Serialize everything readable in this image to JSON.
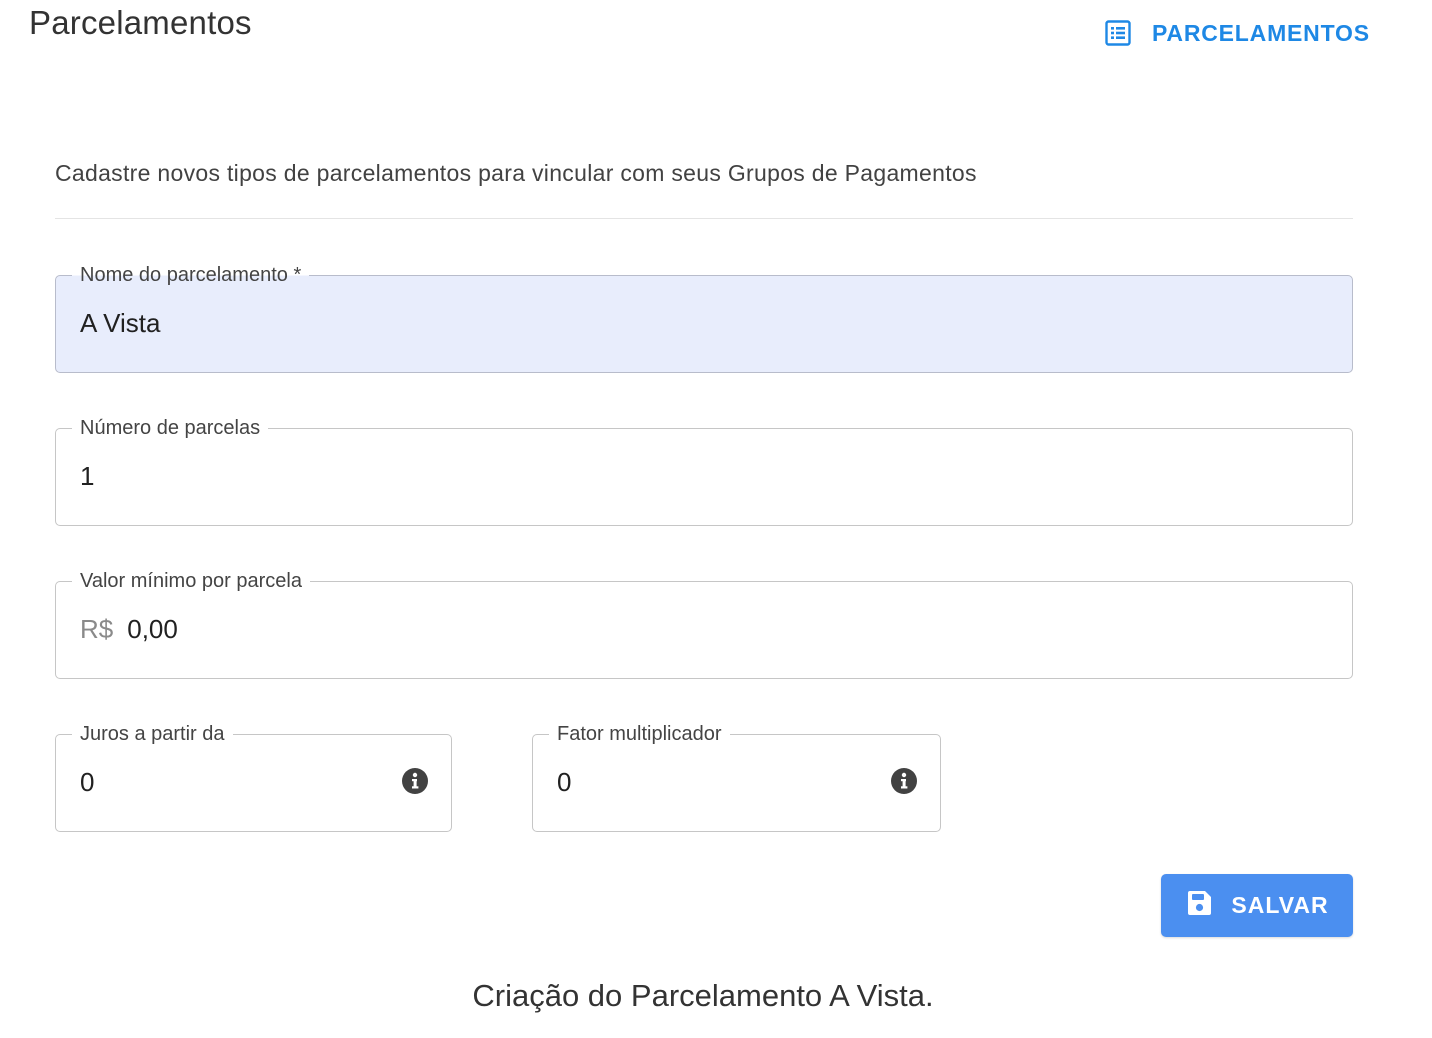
{
  "header": {
    "title": "Parcelamentos",
    "link_label": "PARCELAMENTOS",
    "link_icon": "list-icon"
  },
  "description": "Cadastre novos tipos de parcelamentos para vincular com seus Grupos de Pagamentos",
  "form": {
    "nome": {
      "label": "Nome do parcelamento *",
      "value": "A Vista"
    },
    "numero_parcelas": {
      "label": "Número de parcelas",
      "value": "1"
    },
    "valor_minimo": {
      "label": "Valor mínimo por parcela",
      "prefix": "R$",
      "value": "0,00"
    },
    "juros": {
      "label": "Juros a partir da",
      "value": "0",
      "icon": "info-icon"
    },
    "fator": {
      "label": "Fator multiplicador",
      "value": "0",
      "icon": "info-icon"
    }
  },
  "actions": {
    "save_label": "SALVAR",
    "save_icon": "save-icon"
  },
  "caption": "Criação do Parcelamento A Vista.",
  "colors": {
    "accent": "#1e88e5",
    "button": "#4b8ff0",
    "filled_input": "#e8edfc"
  }
}
